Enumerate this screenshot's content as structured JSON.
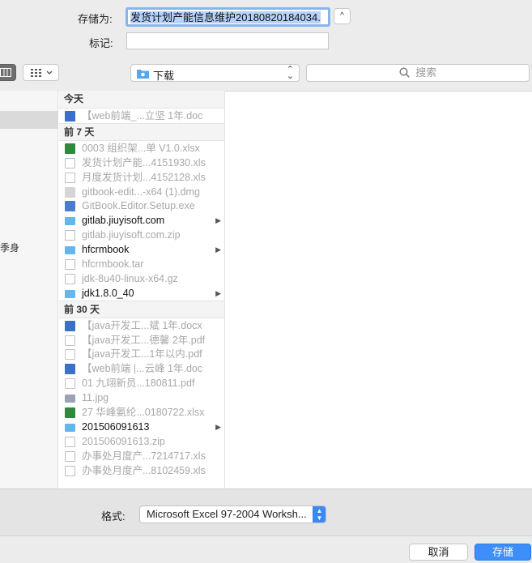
{
  "form": {
    "save_as_label": "存储为:",
    "save_as_value": "发货计划产能信息维护20180820184034.",
    "expand_glyph": "^",
    "tags_label": "标记:",
    "tags_value": ""
  },
  "toolbar": {
    "view_mode": "column-view-icon",
    "arrange_glyph": "⊞ ⌄",
    "location": "下载",
    "search_placeholder": "搜索"
  },
  "sidebar": {
    "partial_text": "季身"
  },
  "groups": [
    {
      "title": "今天",
      "files": [
        {
          "name": "【web前端_...立坚 1年.doc",
          "icon": "word-doc-icon",
          "enabled": false,
          "folder": false
        }
      ]
    },
    {
      "title": "前 7 天",
      "files": [
        {
          "name": "0003 组织架...单 V1.0.xlsx",
          "icon": "excel-icon",
          "enabled": false,
          "folder": false
        },
        {
          "name": "发货计划产能...4151930.xls",
          "icon": "file-icon",
          "enabled": false,
          "folder": false
        },
        {
          "name": "月度发货计划...4152128.xls",
          "icon": "file-icon",
          "enabled": false,
          "folder": false
        },
        {
          "name": "gitbook-edit...-x64 (1).dmg",
          "icon": "dmg-icon",
          "enabled": false,
          "folder": false
        },
        {
          "name": "GitBook.Editor.Setup.exe",
          "icon": "exe-icon",
          "enabled": false,
          "folder": false
        },
        {
          "name": "gitlab.jiuyisoft.com",
          "icon": "folder-icon",
          "enabled": true,
          "folder": true
        },
        {
          "name": "gitlab.jiuyisoft.com.zip",
          "icon": "file-icon",
          "enabled": false,
          "folder": false
        },
        {
          "name": "hfcrmbook",
          "icon": "folder-icon",
          "enabled": true,
          "folder": true
        },
        {
          "name": "hfcrmbook.tar",
          "icon": "file-icon",
          "enabled": false,
          "folder": false
        },
        {
          "name": "jdk-8u40-linux-x64.gz",
          "icon": "file-icon",
          "enabled": false,
          "folder": false
        },
        {
          "name": "jdk1.8.0_40",
          "icon": "folder-icon",
          "enabled": true,
          "folder": true
        }
      ]
    },
    {
      "title": "前 30 天",
      "files": [
        {
          "name": "【java开发工...斌 1年.docx",
          "icon": "word-doc-icon",
          "enabled": false,
          "folder": false
        },
        {
          "name": "【java开发工...德馨 2年.pdf",
          "icon": "pdf-icon",
          "enabled": false,
          "folder": false
        },
        {
          "name": "【java开发工...1年以内.pdf",
          "icon": "pdf-icon",
          "enabled": false,
          "folder": false
        },
        {
          "name": "【web前端 |...云峰 1年.doc",
          "icon": "word-doc-icon",
          "enabled": false,
          "folder": false
        },
        {
          "name": "01 九翊新员...180811.pdf",
          "icon": "pdf-icon",
          "enabled": false,
          "folder": false
        },
        {
          "name": "11.jpg",
          "icon": "image-icon",
          "enabled": false,
          "folder": false
        },
        {
          "name": "27 华峰氨纶...0180722.xlsx",
          "icon": "excel-icon",
          "enabled": false,
          "folder": false
        },
        {
          "name": "201506091613",
          "icon": "folder-icon",
          "enabled": true,
          "folder": true
        },
        {
          "name": "201506091613.zip",
          "icon": "file-icon",
          "enabled": false,
          "folder": false
        },
        {
          "name": "办事处月度产...7214717.xls",
          "icon": "file-icon",
          "enabled": false,
          "folder": false
        },
        {
          "name": "办事处月度产...8102459.xls",
          "icon": "file-icon",
          "enabled": false,
          "folder": false
        }
      ]
    }
  ],
  "format": {
    "label": "格式:",
    "value": "Microsoft Excel 97-2004 Worksh..."
  },
  "buttons": {
    "cancel": "取消",
    "save": "存储"
  },
  "colors": {
    "accent": "#3d8ef8",
    "selection": "#b6d3fb"
  }
}
